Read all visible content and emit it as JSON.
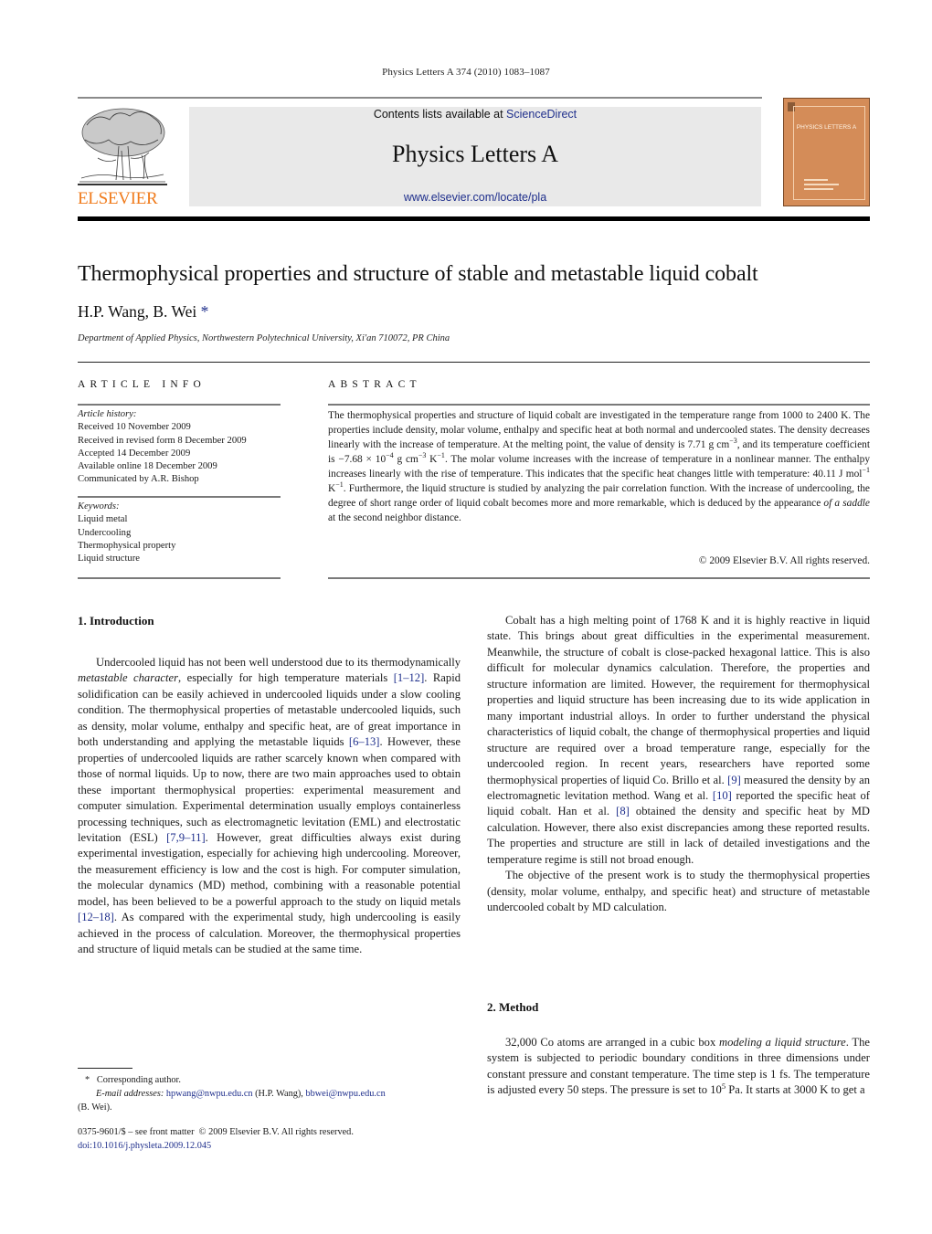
{
  "running_head": "Physics Letters A 374 (2010) 1083–1087",
  "publisher": {
    "logo_text": "ELSEVIER",
    "logo_icon": "elsevier-tree-icon",
    "logo_color": "#f07b1c"
  },
  "banner": {
    "contents_prefix": "Contents lists available at ",
    "contents_link": "ScienceDirect",
    "journal_name": "Physics Letters A",
    "journal_url": "www.elsevier.com/locate/pla",
    "link_color": "#1f2f8c",
    "background": "#e9e9e9"
  },
  "cover": {
    "title": "PHYSICS LETTERS A",
    "color": "#d48c58"
  },
  "article": {
    "title": "Thermophysical properties and structure of stable and metastable liquid cobalt",
    "authors": "H.P. Wang, B. Wei",
    "corresponding_marker": "*",
    "affiliation": "Department of Applied Physics, Northwestern Polytechnical University, Xi'an 710072, PR China"
  },
  "article_info": {
    "heading": "ARTICLE INFO",
    "history_label": "Article history:",
    "history": [
      "Received 10 November 2009",
      "Received in revised form 8 December 2009",
      "Accepted 14 December 2009",
      "Available online 18 December 2009",
      "Communicated by A.R. Bishop"
    ],
    "keywords_label": "Keywords:",
    "keywords": [
      "Liquid metal",
      "Undercooling",
      "Thermophysical property",
      "Liquid structure"
    ]
  },
  "abstract": {
    "heading": "ABSTRACT",
    "p1": "The thermophysical properties and structure of liquid cobalt are investigated in the temperature range from 1000 to 2400 K. The properties include density, molar volume, enthalpy and specific heat at both normal and undercooled states. The density decreases linearly with the increase of temperature. At the melting point, the value of density is 7.71 g cm",
    "sup1": "−3",
    "p2": ", and its temperature coefficient is −7.68 × 10",
    "sup2": "−4",
    "p3": " g cm",
    "sup3": "−3",
    "p4": " K",
    "sup4": "−1",
    "p5": ". The molar volume increases with the increase of temperature in a nonlinear manner. The enthalpy increases linearly with the rise of temperature. This indicates that the specific heat changes little with temperature: 40.11 J mol",
    "sup5": "−1",
    "p6": " K",
    "sup6": "−1",
    "p7": ". Furthermore, the liquid structure is studied by analyzing the pair correlation function. With the increase of undercooling, the degree of short range order of liquid cobalt becomes more and more remarkable, which is deduced by the appearance ",
    "italic": "of a saddle",
    "p8": " at the second neighbor distance.",
    "copyright": "© 2009 Elsevier B.V. All rights reserved."
  },
  "introduction": {
    "heading": "1. Introduction",
    "p1_a": "Undercooled liquid has not been well understood due to its thermodynamically ",
    "p1_italic": "metastable character",
    "p1_b": ", especially for high temperature materials ",
    "cite1": "[1–12]",
    "p1_c": ". Rapid solidification can be easily achieved in undercooled liquids under a slow cooling condition. The thermophysical properties of metastable undercooled liquids, such as density, molar volume, enthalpy and specific heat, are of great importance in both understanding and applying the metastable liquids ",
    "cite2": "[6–13]",
    "p1_d": ". However, these properties of undercooled liquids are rather scarcely known when compared with those of normal liquids. Up to now, there are two main approaches used to obtain these important thermophysical properties: experimental measurement and computer simulation. Experimental determination usually employs containerless processing techniques, such as electromagnetic levitation (EML) and electrostatic levitation (ESL) ",
    "cite3": "[7,9–11]",
    "p1_e": ". However, great difficulties always exist during experimental investigation, especially for achieving high undercooling. Moreover, the measurement efficiency is low and the cost is high. For computer simulation, the molecular dynamics (MD) method, combining with a reasonable potential model, has been believed to be a powerful approach to the study on liquid metals ",
    "cite4": "[12–18]",
    "p1_f": ". As compared with the experimental study, high undercooling is easily achieved in the process of calculation. Moreover, the thermophysical properties and structure of liquid metals can be studied at the same time.",
    "p2_a": "Cobalt has a high melting point of 1768 K and it is highly reactive in liquid state. This brings about great difficulties in the experimental measurement. Meanwhile, the structure of cobalt is close-packed hexagonal lattice. This is also difficult for molecular dynamics calculation. Therefore, the properties and structure information are limited. However, the requirement for thermophysical properties and liquid structure has been increasing due to its wide application in many important industrial alloys. In order to further understand the physical characteristics of liquid cobalt, the change of thermophysical properties and liquid structure are required over a broad temperature range, especially for the undercooled region. In recent years, researchers have reported some thermophysical properties of liquid Co. Brillo et al. ",
    "cite5": "[9]",
    "p2_b": " measured the density by an electromagnetic levitation method. Wang et al. ",
    "cite6": "[10]",
    "p2_c": " reported the specific heat of liquid cobalt. Han et al. ",
    "cite7": "[8]",
    "p2_d": " obtained the density and specific heat by MD calculation. However, there also exist discrepancies among these reported results. The properties and structure are still in lack of detailed investigations and the temperature regime is still not broad enough.",
    "p3": "The objective of the present work is to study the thermophysical properties (density, molar volume, enthalpy, and specific heat) and structure of metastable undercooled cobalt by MD calculation."
  },
  "method": {
    "heading": "2. Method",
    "p1_a": "32,000 Co atoms are arranged in a cubic box ",
    "p1_italic": "modeling a liquid structure",
    "p1_b": ". The system is subjected to periodic boundary conditions in three dimensions under constant pressure and constant temperature. The time step is 1 fs. The temperature is adjusted every 50 steps. The pressure is set to 10",
    "sup": "5",
    "p1_c": " Pa. It starts at 3000 K to get a"
  },
  "footnote": {
    "marker": "*",
    "corresponding": "Corresponding author.",
    "email_label": "E-mail addresses:",
    "email1": "hpwang@nwpu.edu.cn",
    "email1_owner": " (H.P. Wang), ",
    "email2": "bbwei@nwpu.edu.cn",
    "email2_owner": "(B. Wei)."
  },
  "bottom_meta": {
    "issn_line": "0375-9601/$ – see front matter  © 2009 Elsevier B.V. All rights reserved.",
    "doi": "doi:10.1016/j.physleta.2009.12.045"
  }
}
